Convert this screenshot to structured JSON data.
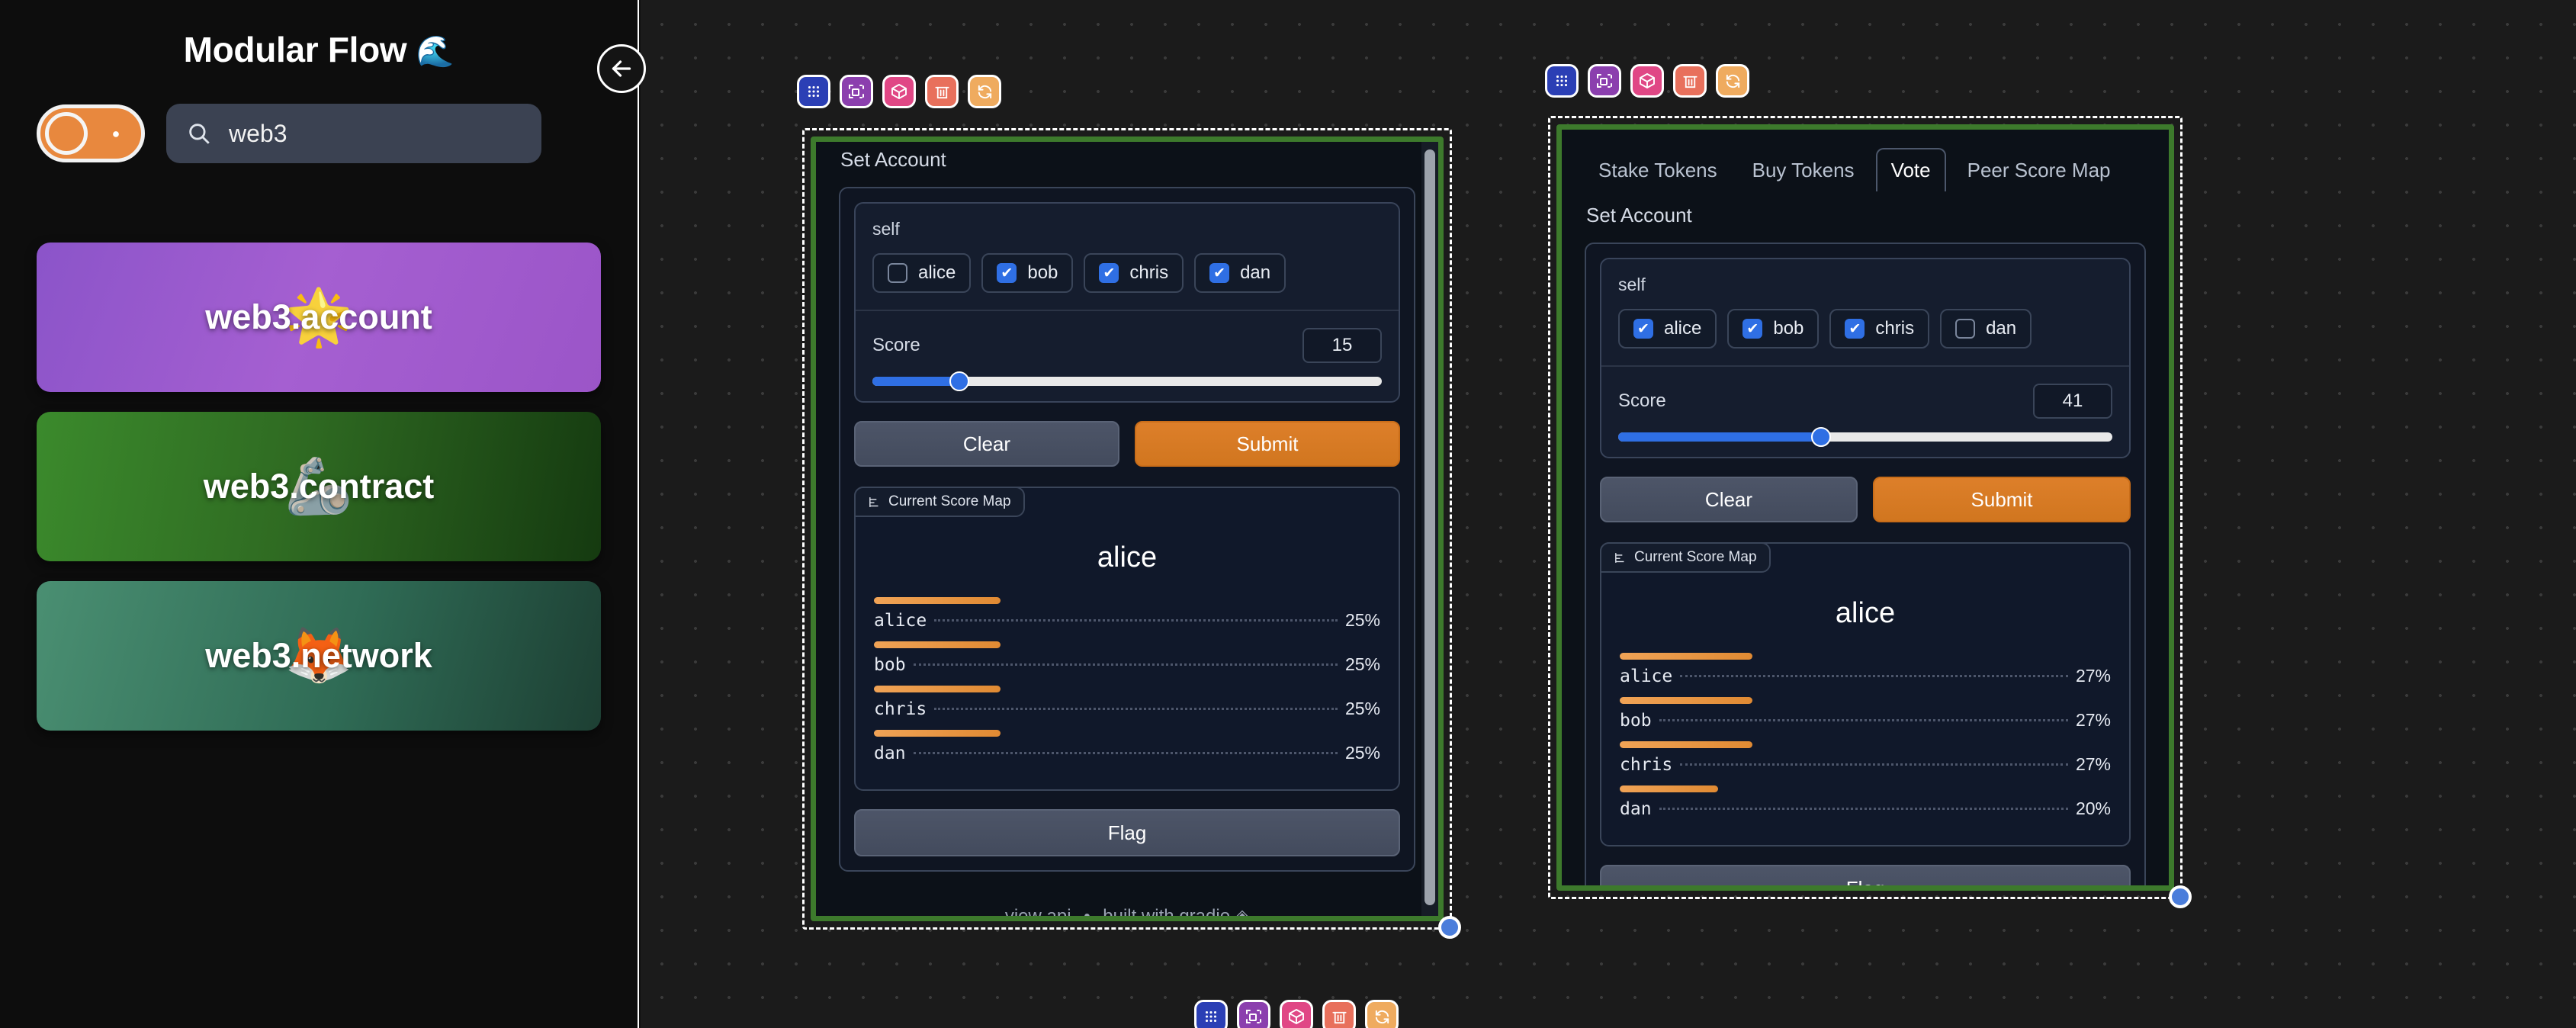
{
  "sidebar": {
    "title": "Modular Flow",
    "title_emoji": "🌊",
    "toggle": {
      "name": "brand-toggle",
      "color": "#e8883e"
    },
    "search": {
      "value": "web3",
      "placeholder": "search"
    },
    "cards": [
      {
        "label": "web3.account",
        "emoji": "🌟",
        "color": "#9b55c8"
      },
      {
        "label": "web3.contract",
        "emoji": "🦾",
        "color": "#2f6b22"
      },
      {
        "label": "web3.network",
        "emoji": "🦊",
        "color": "#2f6b55"
      }
    ],
    "back_button": "←"
  },
  "toolbar": {
    "buttons": [
      {
        "name": "grid-icon",
        "title": "Grid",
        "color": "#2b3fb5"
      },
      {
        "name": "resize-icon",
        "title": "Resize",
        "color": "#8b3fae"
      },
      {
        "name": "cube-icon",
        "title": "Module",
        "color": "#e04785"
      },
      {
        "name": "trash-icon",
        "title": "Delete",
        "color": "#e8705c"
      },
      {
        "name": "sync-icon",
        "title": "Refresh",
        "color": "#efab5f"
      }
    ]
  },
  "nodes": [
    {
      "id": "node-left",
      "section_title": "Set Account",
      "field_label": "self",
      "checkboxes": [
        {
          "label": "alice",
          "checked": false
        },
        {
          "label": "bob",
          "checked": true
        },
        {
          "label": "chris",
          "checked": true
        },
        {
          "label": "dan",
          "checked": true
        }
      ],
      "slider": {
        "label": "Score",
        "value": "15",
        "percent": 15
      },
      "buttons": {
        "clear": "Clear",
        "submit": "Submit",
        "flag": "Flag"
      },
      "score_map": {
        "tag": "Current Score Map",
        "title": "alice",
        "rows": [
          {
            "name": "alice",
            "pct": "25%",
            "bar": 25
          },
          {
            "name": "bob",
            "pct": "25%",
            "bar": 25
          },
          {
            "name": "chris",
            "pct": "25%",
            "bar": 25
          },
          {
            "name": "dan",
            "pct": "25%",
            "bar": 25
          }
        ]
      },
      "footer": {
        "api": "view api",
        "sep": "•",
        "built": "built with gradio",
        "logo": "◈"
      }
    },
    {
      "id": "node-right",
      "tabs": [
        {
          "label": "Stake Tokens",
          "active": false
        },
        {
          "label": "Buy Tokens",
          "active": false
        },
        {
          "label": "Vote",
          "active": true
        },
        {
          "label": "Peer Score Map",
          "active": false
        }
      ],
      "section_title": "Set Account",
      "field_label": "self",
      "checkboxes": [
        {
          "label": "alice",
          "checked": true
        },
        {
          "label": "bob",
          "checked": true
        },
        {
          "label": "chris",
          "checked": true
        },
        {
          "label": "dan",
          "checked": false
        }
      ],
      "slider": {
        "label": "Score",
        "value": "41",
        "percent": 41
      },
      "buttons": {
        "clear": "Clear",
        "submit": "Submit",
        "flag": "Flag"
      },
      "score_map": {
        "tag": "Current Score Map",
        "title": "alice",
        "rows": [
          {
            "name": "alice",
            "pct": "27%",
            "bar": 27
          },
          {
            "name": "bob",
            "pct": "27%",
            "bar": 27
          },
          {
            "name": "chris",
            "pct": "27%",
            "bar": 27
          },
          {
            "name": "dan",
            "pct": "20%",
            "bar": 20
          }
        ]
      }
    }
  ],
  "chart_data": [
    {
      "type": "bar",
      "title": "alice",
      "categories": [
        "alice",
        "bob",
        "chris",
        "dan"
      ],
      "values": [
        25,
        25,
        25,
        25
      ],
      "labels": [
        "25%",
        "25%",
        "25%",
        "25%"
      ],
      "xlabel": "",
      "ylabel": "",
      "ylim": [
        0,
        100
      ],
      "legend": "none",
      "grid": false
    },
    {
      "type": "bar",
      "title": "alice",
      "categories": [
        "alice",
        "bob",
        "chris",
        "dan"
      ],
      "values": [
        27,
        27,
        27,
        20
      ],
      "labels": [
        "27%",
        "27%",
        "27%",
        "20%"
      ],
      "xlabel": "",
      "ylabel": "",
      "ylim": [
        0,
        100
      ],
      "legend": "none",
      "grid": false
    }
  ]
}
